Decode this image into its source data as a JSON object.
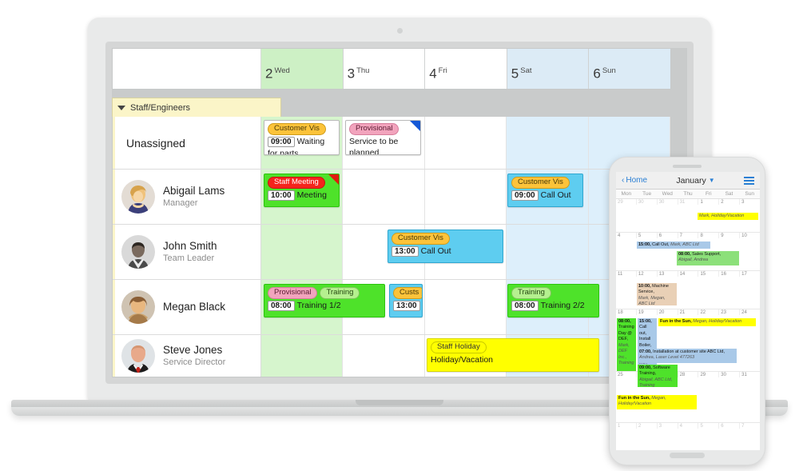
{
  "scheduler": {
    "month": "January",
    "group_label": "Staff/Engineers",
    "day_headers": [
      {
        "num": "2",
        "name": "Wed",
        "tone": "green"
      },
      {
        "num": "3",
        "name": "Thu",
        "tone": "white"
      },
      {
        "num": "4",
        "name": "Fri",
        "tone": "white"
      },
      {
        "num": "5",
        "name": "Sat",
        "tone": "blue"
      },
      {
        "num": "6",
        "name": "Sun",
        "tone": "blue"
      }
    ],
    "rows": [
      {
        "name": "Unassigned",
        "role": ""
      },
      {
        "name": "Abigail Lams",
        "role": "Manager"
      },
      {
        "name": "John Smith",
        "role": "Team Leader"
      },
      {
        "name": "Megan Black",
        "role": ""
      },
      {
        "name": "Steve Jones",
        "role": "Service Director"
      }
    ],
    "events": {
      "unassigned_1": {
        "badges": [
          "Customer Vis"
        ],
        "time": "09:00",
        "title": "Waiting",
        "body": "for parts"
      },
      "unassigned_2": {
        "badges": [
          "Provisional"
        ],
        "time": "",
        "title": "Service to be",
        "body": "planned"
      },
      "abigail_1": {
        "badges": [
          "Staff Meeting"
        ],
        "time": "10:00",
        "title": "Meeting",
        "body": ""
      },
      "abigail_2": {
        "badges": [
          "Customer Vis"
        ],
        "time": "09:00",
        "title": "Call Out",
        "body": ""
      },
      "john_1": {
        "badges": [
          "Customer Vis"
        ],
        "time": "13:00",
        "title": "Call Out",
        "body": ""
      },
      "megan_1": {
        "badges": [
          "Provisional",
          "Training"
        ],
        "time": "08:00",
        "title": "Training 1/2",
        "body": ""
      },
      "megan_2": {
        "badges": [
          "Custs"
        ],
        "time": "13:00",
        "title": "",
        "body": ""
      },
      "megan_3": {
        "badges": [
          "Training"
        ],
        "time": "08:00",
        "title": "Training 2/2",
        "body": ""
      },
      "steve_1": {
        "badges": [
          "Staff Holiday"
        ],
        "time": "",
        "title": "Holiday/Vacation",
        "body": ""
      }
    }
  },
  "phone": {
    "back_label": "Home",
    "title": "January",
    "day_names": [
      "Mon",
      "Tue",
      "Wed",
      "Thu",
      "Fri",
      "Sat",
      "Sun"
    ],
    "weeks": [
      {
        "nums": [
          "29",
          "30",
          "30",
          "31",
          "1",
          "2",
          "3"
        ],
        "dim": [
          true,
          true,
          true,
          true,
          false,
          false,
          false
        ]
      },
      {
        "nums": [
          "4",
          "5",
          "6",
          "7",
          "8",
          "9",
          "10"
        ],
        "dim": [
          false,
          false,
          false,
          false,
          false,
          false,
          false
        ]
      },
      {
        "nums": [
          "11",
          "12",
          "13",
          "14",
          "15",
          "16",
          "17"
        ],
        "dim": [
          false,
          false,
          false,
          false,
          false,
          false,
          false
        ]
      },
      {
        "nums": [
          "18",
          "19",
          "20",
          "21",
          "22",
          "23",
          "24"
        ],
        "dim": [
          false,
          false,
          false,
          false,
          false,
          false,
          false
        ]
      },
      {
        "nums": [
          "25",
          "26",
          "27",
          "28",
          "29",
          "30",
          "31"
        ],
        "dim": [
          false,
          false,
          false,
          false,
          false,
          false,
          false
        ]
      },
      {
        "nums": [
          "1",
          "2",
          "3",
          "4",
          "5",
          "6",
          "7"
        ],
        "dim": [
          true,
          true,
          true,
          true,
          true,
          true,
          true
        ]
      }
    ],
    "events": {
      "w1_holiday": {
        "time": "",
        "text": "Mark, Holiday/Vacation"
      },
      "w2_callout": {
        "time": "15:00,",
        "text": "Call Out,",
        "detail": "Mark, ABC Ltd"
      },
      "w2_sales": {
        "time": "08:00,",
        "text": "Sales Support,",
        "detail": "Abigail, Andrea"
      },
      "w3_machine": {
        "time": "10:00,",
        "text": "Machine Service,",
        "detail": "Mark, Megan, ABC Ltd"
      },
      "w4_training": {
        "time": "08:00,",
        "text": "Training Day @ DEF,",
        "detail": "Mark, DEF Inc., Training"
      },
      "w4_install": {
        "time": "15:00,",
        "text": "Call out, Install Boiler,",
        "detail": "Mark, DEF Inc., Provisio"
      },
      "w4_fun": {
        "time": "",
        "text": "Fun in the Sun,",
        "detail": "Megan, Holiday/Vacation"
      },
      "w5_installation": {
        "time": "07:00,",
        "text": "Installation at customer site ABC Ltd,",
        "detail": "Andrea, Laser Level 477263"
      },
      "w5_software": {
        "time": "09:00,",
        "text": "Software Training,",
        "detail": "Abigail, ABC Ltd, Training"
      },
      "w6_fun": {
        "time": "",
        "text": "Fun in the Sun,",
        "detail": "Megan, Holiday/Vacation"
      }
    }
  }
}
